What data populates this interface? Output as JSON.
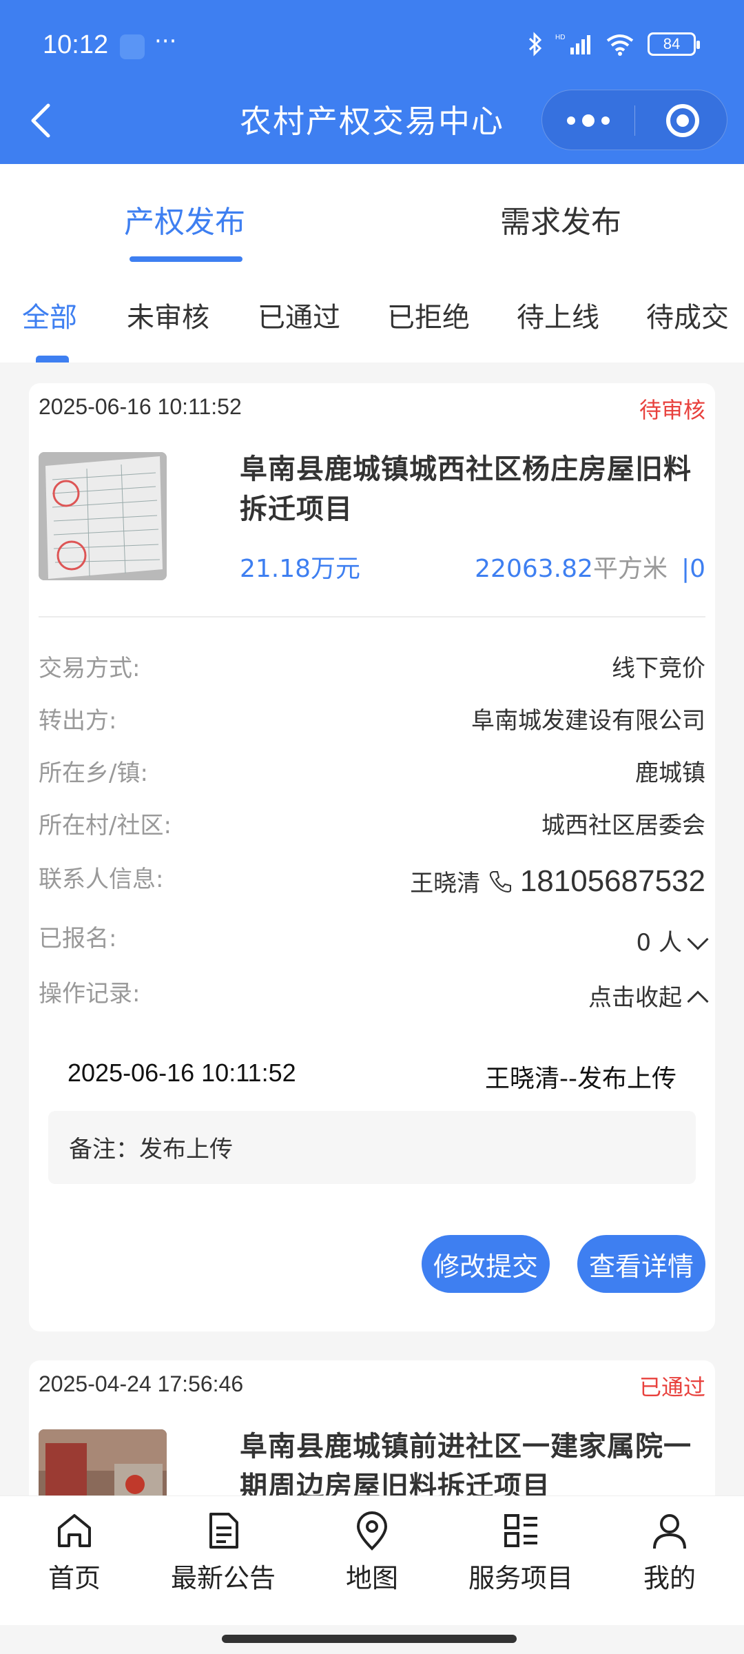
{
  "status_bar": {
    "time": "10:12",
    "dots": "···",
    "battery": "84"
  },
  "header": {
    "title": "农村产权交易中心"
  },
  "main_tabs": [
    {
      "label": "产权发布",
      "active": true
    },
    {
      "label": "需求发布",
      "active": false
    }
  ],
  "sub_tabs": [
    {
      "label": "全部",
      "active": true
    },
    {
      "label": "未审核"
    },
    {
      "label": "已通过"
    },
    {
      "label": "已拒绝"
    },
    {
      "label": "待上线"
    },
    {
      "label": "待成交"
    }
  ],
  "cards": [
    {
      "date": "2025-06-16 10:11:52",
      "status": "待审核",
      "name": "阜南县鹿城镇城西社区杨庄房屋旧料拆迁项目",
      "price": "21.18万元",
      "area": "22063.82",
      "area_unit": "平方米",
      "views": "0",
      "details": {
        "trade_method_label": "交易方式:",
        "trade_method": "线下竞价",
        "transferor_label": "转出方:",
        "transferor": "阜南城发建设有限公司",
        "town_label": "所在乡/镇:",
        "town": "鹿城镇",
        "village_label": "所在村/社区:",
        "village": "城西社区居委会",
        "contact_label": "联系人信息:",
        "contact_name": "王晓清",
        "contact_phone": "18105687532",
        "registered_label": "已报名:",
        "registered": "0 人",
        "log_label": "操作记录:",
        "log_toggle": "点击收起"
      },
      "log": {
        "date": "2025-06-16 10:11:52",
        "action": "王晓清--发布上传",
        "remark": "备注：发布上传"
      },
      "buttons": {
        "edit": "修改提交",
        "view": "查看详情"
      }
    },
    {
      "date": "2025-04-24 17:56:46",
      "status": "已通过",
      "name": "阜南县鹿城镇前进社区一建家属院一期周边房屋旧料拆迁项目"
    }
  ],
  "tabbar": [
    {
      "label": "首页",
      "icon": "home-icon"
    },
    {
      "label": "最新公告",
      "icon": "document-icon"
    },
    {
      "label": "地图",
      "icon": "map-pin-icon"
    },
    {
      "label": "服务项目",
      "icon": "grid-list-icon"
    },
    {
      "label": "我的",
      "icon": "user-icon"
    }
  ],
  "colors": {
    "primary": "#3e7ff1",
    "status_red": "#e8413d"
  }
}
